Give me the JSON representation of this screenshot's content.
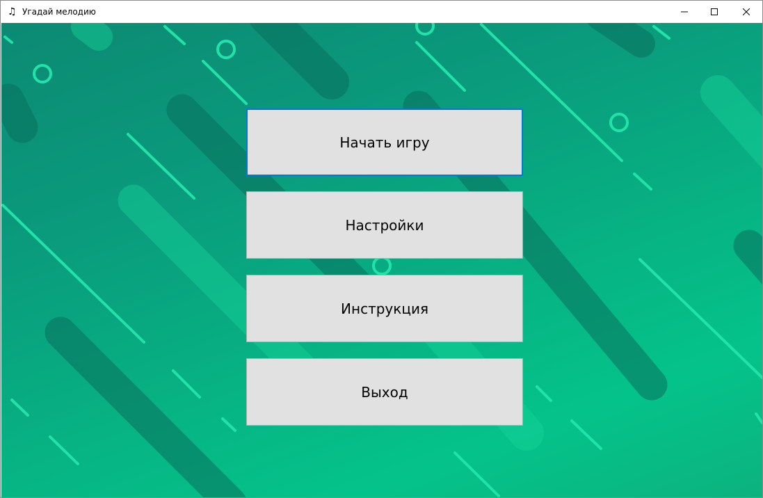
{
  "window": {
    "title": "Угадай мелодию",
    "app_icon": "music-note-icon",
    "caption_buttons": [
      "minimize-icon",
      "maximize-icon",
      "close-icon"
    ]
  },
  "menu": {
    "start_label": "Начать игру",
    "settings_label": "Настройки",
    "instructions_label": "Инструкция",
    "exit_label": "Выход"
  },
  "colors": {
    "background_top": "#0c8a73",
    "background_bottom": "#04c38a",
    "stripe_light": "#1ee6a8",
    "button_face": "#e1e1e1",
    "focus_border": "#0078d7"
  }
}
